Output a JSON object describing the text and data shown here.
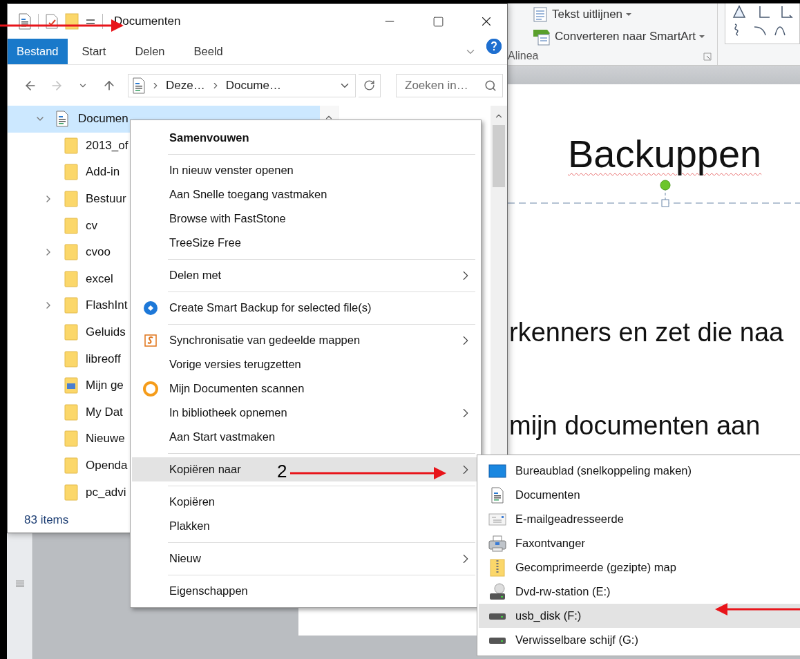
{
  "explorer": {
    "title": "Documenten",
    "ribbon_tabs": [
      {
        "label": "Bestand",
        "selected": true
      },
      {
        "label": "Start",
        "selected": false
      },
      {
        "label": "Delen",
        "selected": false
      },
      {
        "label": "Beeld",
        "selected": false
      }
    ],
    "address_crumbs": [
      "Deze…",
      "Docume…"
    ],
    "search": {
      "placeholder": "Zoeken in…"
    },
    "tree": {
      "label": "Documen",
      "expanded": true,
      "selected": true,
      "children": [
        {
          "label": "2013_of",
          "kind": "folder",
          "has_children": false
        },
        {
          "label": "Add-in",
          "kind": "folder",
          "has_children": false
        },
        {
          "label": "Bestuur",
          "kind": "folder",
          "has_children": true
        },
        {
          "label": "cv",
          "kind": "folder",
          "has_children": false
        },
        {
          "label": "cvoo",
          "kind": "folder",
          "has_children": true
        },
        {
          "label": "excel",
          "kind": "folder",
          "has_children": false
        },
        {
          "label": "FlashInt",
          "kind": "folder",
          "has_children": true
        },
        {
          "label": "Geluids",
          "kind": "folder",
          "has_children": false
        },
        {
          "label": "libreoff",
          "kind": "folder",
          "has_children": false
        },
        {
          "label": "Mijn ge",
          "kind": "shared",
          "has_children": false
        },
        {
          "label": "My Dat",
          "kind": "folder",
          "has_children": false
        },
        {
          "label": "Nieuwe",
          "kind": "folder",
          "has_children": false
        },
        {
          "label": "Openda",
          "kind": "folder",
          "has_children": false
        },
        {
          "label": "pc_advi",
          "kind": "folder",
          "has_children": false
        }
      ]
    },
    "status": "83 items"
  },
  "context_menu": {
    "groups": [
      {
        "items": [
          {
            "label": "Samenvouwen",
            "kind": "plain",
            "default": true,
            "submenu": false,
            "selected": false
          }
        ]
      },
      {
        "items": [
          {
            "label": "In nieuw venster openen",
            "kind": "plain",
            "default": false,
            "submenu": false,
            "selected": false
          },
          {
            "label": "Aan Snelle toegang vastmaken",
            "kind": "plain",
            "default": false,
            "submenu": false,
            "selected": false
          },
          {
            "label": "Browse with FastStone",
            "kind": "plain",
            "default": false,
            "submenu": false,
            "selected": false
          },
          {
            "label": "TreeSize Free",
            "kind": "plain",
            "default": false,
            "submenu": false,
            "selected": false
          }
        ]
      },
      {
        "items": [
          {
            "label": "Delen met",
            "kind": "plain",
            "default": false,
            "submenu": true,
            "selected": false
          }
        ]
      },
      {
        "items": [
          {
            "label": "Create Smart Backup for selected file(s)",
            "kind": "backup",
            "default": false,
            "submenu": false,
            "selected": false
          }
        ]
      },
      {
        "items": [
          {
            "label": "Synchronisatie van gedeelde mappen",
            "kind": "sync",
            "default": false,
            "submenu": true,
            "selected": false
          },
          {
            "label": "Vorige versies terugzetten",
            "kind": "plain",
            "default": false,
            "submenu": false,
            "selected": false
          },
          {
            "label": "Mijn Documenten scannen",
            "kind": "scan",
            "default": false,
            "submenu": false,
            "selected": false
          },
          {
            "label": "In bibliotheek opnemen",
            "kind": "plain",
            "default": false,
            "submenu": true,
            "selected": false
          },
          {
            "label": "Aan Start vastmaken",
            "kind": "plain",
            "default": false,
            "submenu": false,
            "selected": false
          }
        ]
      },
      {
        "items": [
          {
            "label": "Kopiëren naar",
            "kind": "plain",
            "default": false,
            "submenu": true,
            "selected": true
          }
        ]
      },
      {
        "items": [
          {
            "label": "Kopiëren",
            "kind": "plain",
            "default": false,
            "submenu": false,
            "selected": false
          },
          {
            "label": "Plakken",
            "kind": "plain",
            "default": false,
            "submenu": false,
            "selected": false
          }
        ]
      },
      {
        "items": [
          {
            "label": "Nieuw",
            "kind": "plain",
            "default": false,
            "submenu": true,
            "selected": false
          }
        ]
      },
      {
        "items": [
          {
            "label": "Eigenschappen",
            "kind": "plain",
            "default": false,
            "submenu": false,
            "selected": false
          }
        ]
      }
    ]
  },
  "submenu": {
    "items": [
      {
        "label": "Bureaublad (snelkoppeling maken)",
        "kind": "desktop",
        "selected": false
      },
      {
        "label": "Documenten",
        "kind": "document",
        "selected": false
      },
      {
        "label": "E-mailgeadresseerde",
        "kind": "mail",
        "selected": false
      },
      {
        "label": "Faxontvanger",
        "kind": "fax",
        "selected": false
      },
      {
        "label": "Gecomprimeerde (gezipte) map",
        "kind": "zip",
        "selected": false
      },
      {
        "label": "Dvd-rw-station (E:)",
        "kind": "dvd",
        "selected": false
      },
      {
        "label": "usb_disk (F:)",
        "kind": "drive",
        "selected": true
      },
      {
        "label": "Verwisselbare schijf (G:)",
        "kind": "drive",
        "selected": false
      }
    ]
  },
  "presentation": {
    "ribbon": {
      "buttons": [
        {
          "label": "Tekst uitlijnen",
          "kind": "align"
        },
        {
          "label": "Converteren naar SmartArt",
          "kind": "smartart"
        }
      ],
      "group_label": "Alinea"
    },
    "slide": {
      "title": "Backuppen",
      "lines": [
        "rkenners en zet die naa",
        "mijn documenten aan"
      ]
    }
  },
  "annotations": {
    "step_label": "2"
  }
}
